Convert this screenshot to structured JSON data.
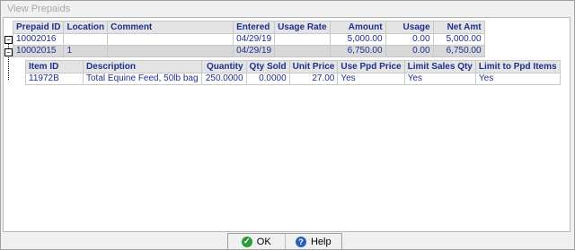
{
  "window": {
    "title": "View Prepaids"
  },
  "master": {
    "columns": [
      "Prepaid ID",
      "Location",
      "Comment",
      "Entered",
      "Usage Rate",
      "Amount",
      "Usage",
      "Net Amt"
    ],
    "rows": [
      [
        "10002016",
        "",
        "",
        "04/29/19",
        "",
        "5,000.00",
        "0.00",
        "5,000.00"
      ],
      [
        "10002015",
        "1",
        "",
        "04/29/19",
        "",
        "6,750.00",
        "0.00",
        "6,750.00"
      ]
    ]
  },
  "detail": {
    "columns": [
      "Item ID",
      "Description",
      "Quantity",
      "Qty Sold",
      "Unit Price",
      "Use Ppd Price",
      "Limit Sales Qty",
      "Limit to Ppd Items"
    ],
    "rows": [
      [
        "11972B",
        "Total Equine Feed, 50lb bag",
        "250.0000",
        "0.0000",
        "27.00",
        "Yes",
        "Yes",
        "Yes"
      ]
    ]
  },
  "buttons": {
    "ok": "OK",
    "help": "Help"
  },
  "icons": {
    "ok": "check-icon",
    "help": "question-icon"
  },
  "colors": {
    "header_text": "#1f2f8c",
    "selected_row": "#d8d8d8",
    "ok_icon": "#2e9a3a",
    "help_icon": "#2b5fb5"
  }
}
